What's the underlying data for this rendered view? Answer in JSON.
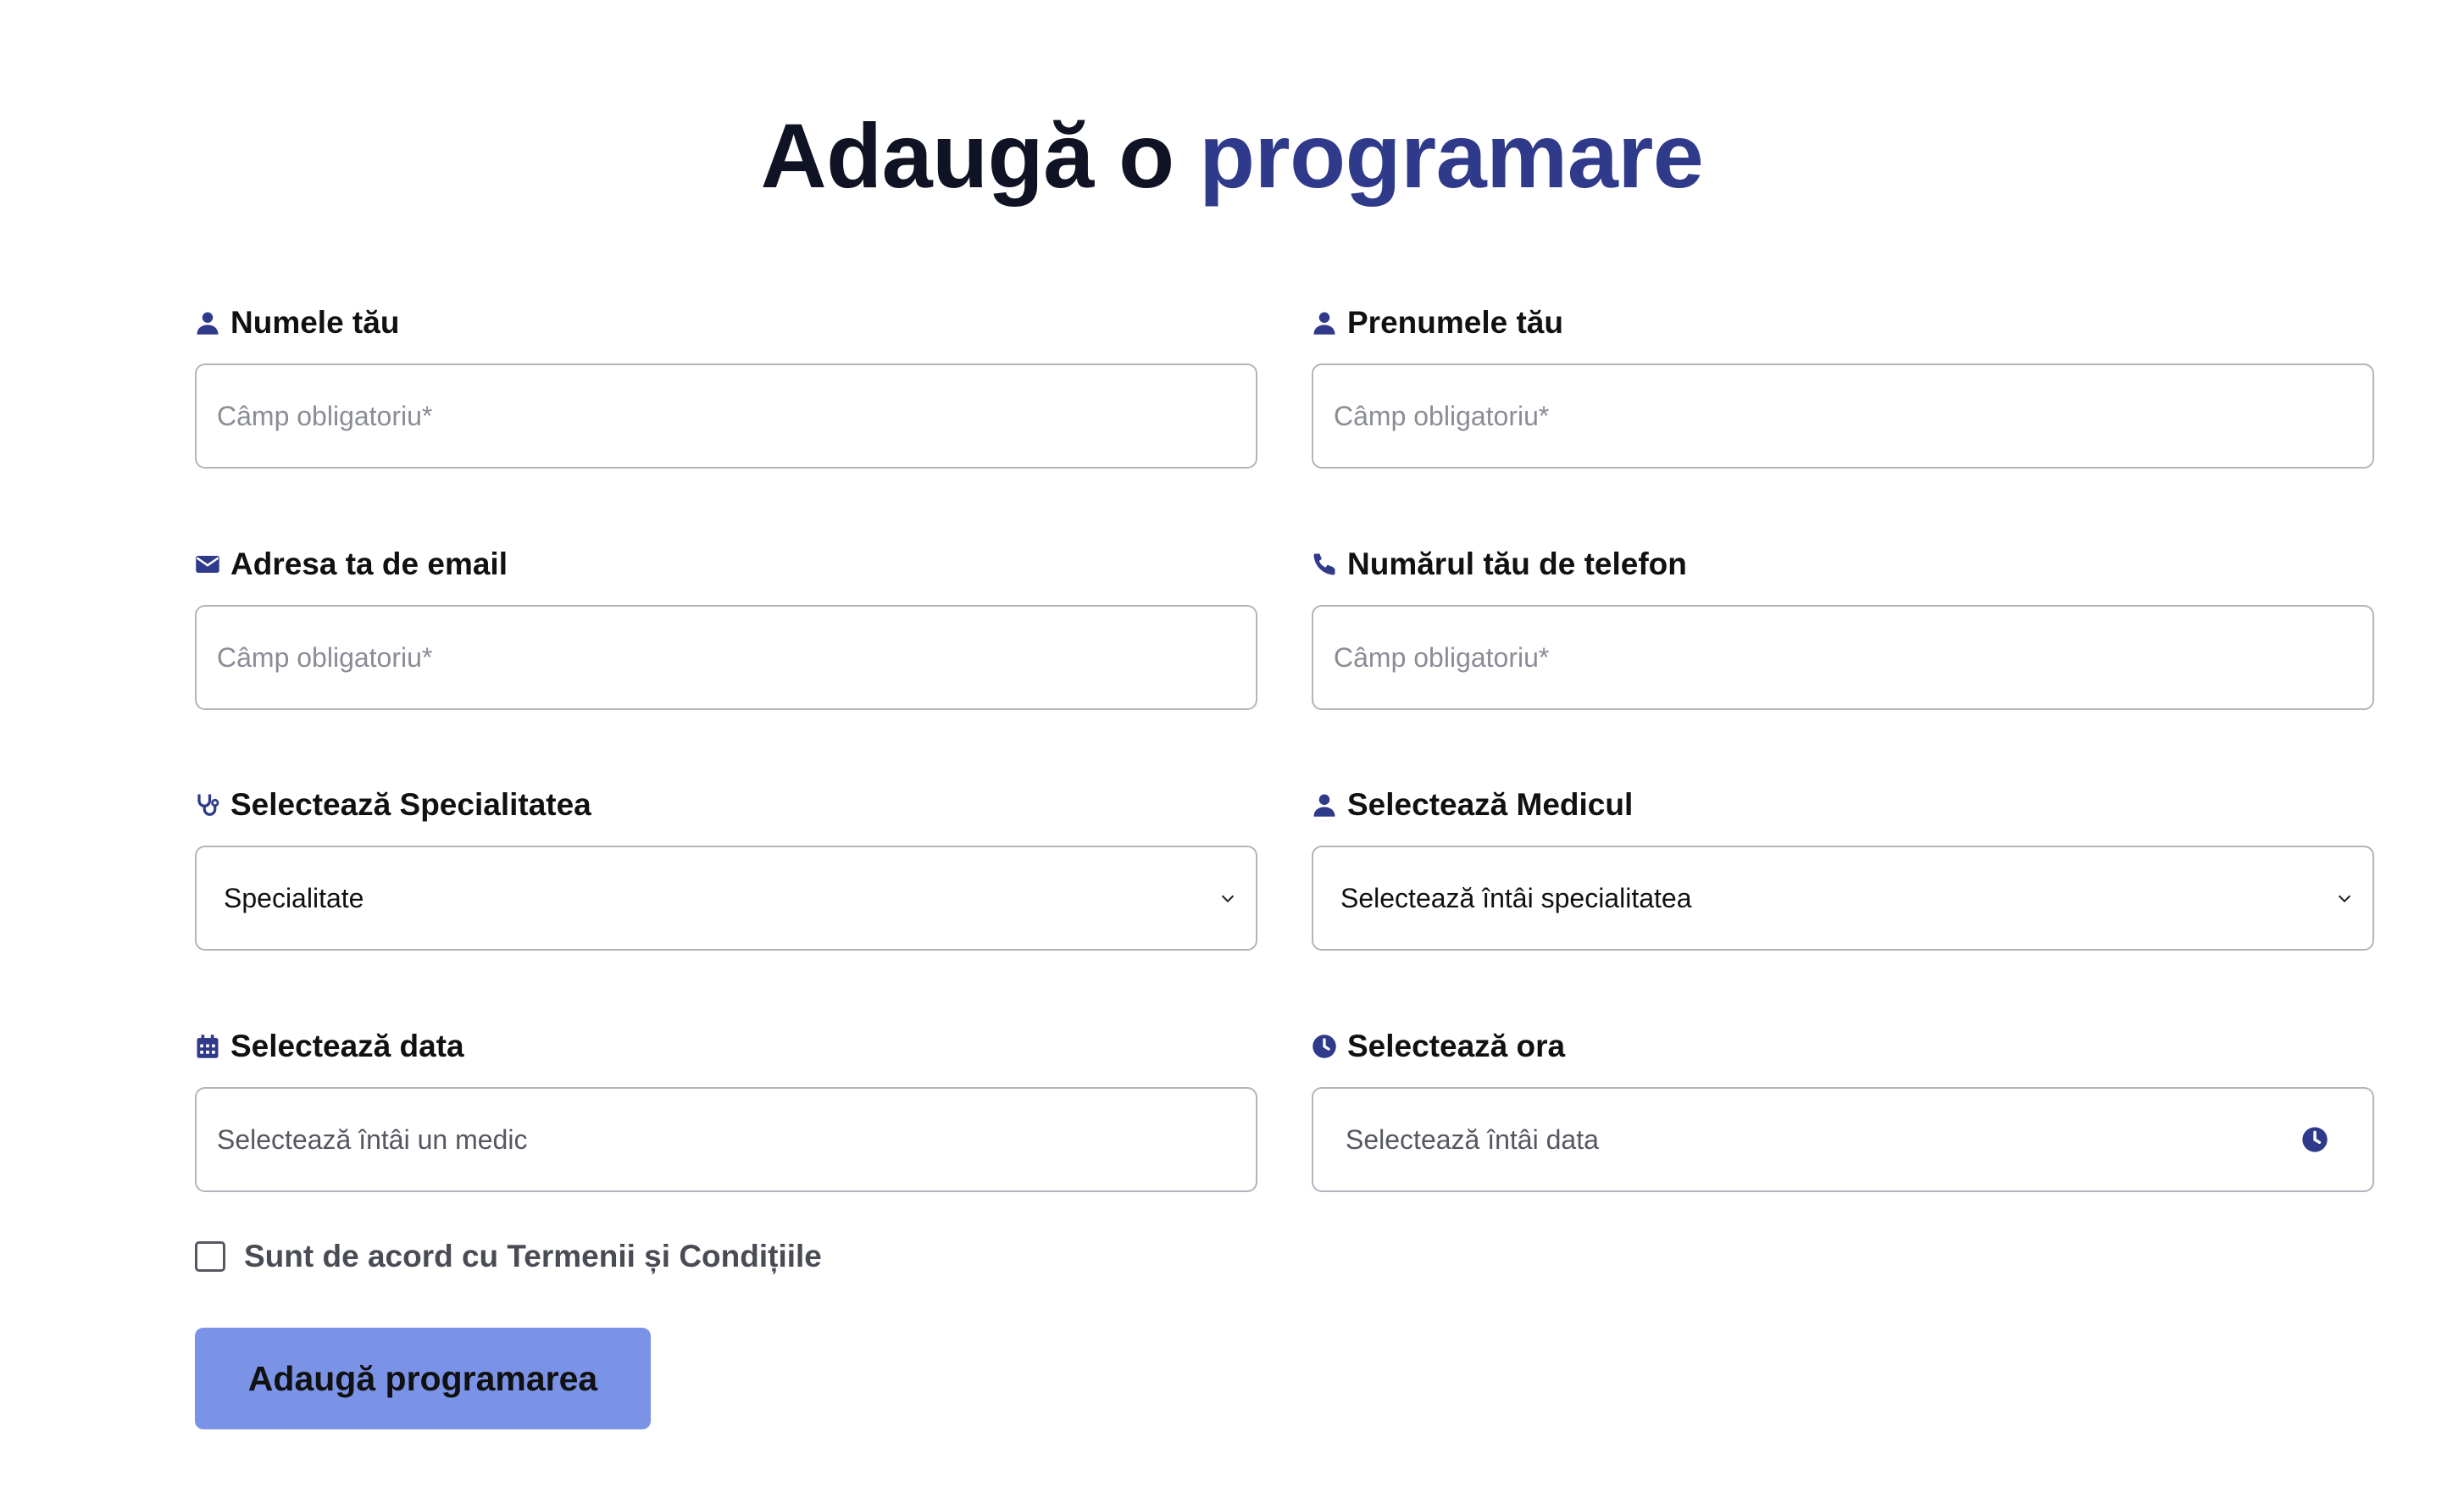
{
  "page": {
    "title_part1": "Adaugă o",
    "title_part2": "programare"
  },
  "form": {
    "last_name": {
      "label": "Numele tău",
      "icon": "user-icon",
      "placeholder": "Câmp obligatoriu*"
    },
    "first_name": {
      "label": "Prenumele tău",
      "icon": "user-icon",
      "placeholder": "Câmp obligatoriu*"
    },
    "email": {
      "label": "Adresa ta de email",
      "icon": "envelope-icon",
      "placeholder": "Câmp obligatoriu*"
    },
    "phone": {
      "label": "Numărul tău de telefon",
      "icon": "phone-icon",
      "placeholder": "Câmp obligatoriu*"
    },
    "specialty": {
      "label": "Selectează Specialitatea",
      "icon": "stethoscope-icon",
      "value": "Specialitate"
    },
    "doctor": {
      "label": "Selectează Medicul",
      "icon": "user-icon",
      "value": "Selectează întâi specialitatea"
    },
    "date": {
      "label": "Selectează data",
      "icon": "calendar-icon",
      "value": "Selectează întâi un medic"
    },
    "time": {
      "label": "Selectează ora",
      "icon": "clock-icon",
      "value": "Selectează întâi data"
    },
    "terms": {
      "label": "Sunt de acord cu Termenii și Condițiile",
      "checked": false
    },
    "submit_label": "Adaugă programarea"
  },
  "colors": {
    "accent": "#2f3a8a",
    "button": "#7a93e6",
    "icon": "#2f3a8a",
    "border": "#b3b5bd"
  }
}
